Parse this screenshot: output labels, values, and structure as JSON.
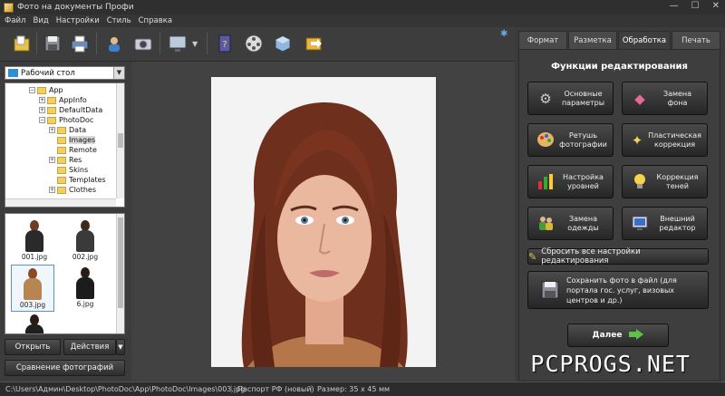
{
  "window": {
    "title": "Фото на документы Профи"
  },
  "menu": [
    "Файл",
    "Вид",
    "Настройки",
    "Стиль",
    "Справка"
  ],
  "toolbar": {
    "icons": [
      "open-folder-icon",
      "save-icon",
      "print-icon",
      "camera-user-icon",
      "webcam-icon",
      "monitor-icon",
      "help-book-icon",
      "film-icon",
      "box-3d-icon",
      "export-icon"
    ]
  },
  "folder": {
    "selected": "Рабочий стол"
  },
  "tree": {
    "items": [
      {
        "label": "App",
        "indent": 2,
        "toggle": "−"
      },
      {
        "label": "AppInfo",
        "indent": 3,
        "toggle": "+"
      },
      {
        "label": "DefaultData",
        "indent": 3,
        "toggle": "+"
      },
      {
        "label": "PhotoDoc",
        "indent": 3,
        "toggle": "−"
      },
      {
        "label": "Data",
        "indent": 4,
        "toggle": "+"
      },
      {
        "label": "Images",
        "indent": 4,
        "toggle": "",
        "selected": true
      },
      {
        "label": "Remote",
        "indent": 4,
        "toggle": ""
      },
      {
        "label": "Res",
        "indent": 4,
        "toggle": "+"
      },
      {
        "label": "Skins",
        "indent": 4,
        "toggle": ""
      },
      {
        "label": "Templates",
        "indent": 4,
        "toggle": ""
      },
      {
        "label": "Clothes",
        "indent": 4,
        "toggle": "+"
      }
    ]
  },
  "thumbnails": [
    {
      "label": "001.jpg",
      "selected": false
    },
    {
      "label": "002.jpg",
      "selected": false
    },
    {
      "label": "003.jpg",
      "selected": true
    },
    {
      "label": "6.jpg",
      "selected": false
    }
  ],
  "left_buttons": {
    "open": "Открыть",
    "actions": "Действия",
    "compare": "Сравнение фотографий"
  },
  "tabs": [
    {
      "label": "Формат",
      "active": false
    },
    {
      "label": "Разметка",
      "active": false
    },
    {
      "label": "Обработка",
      "active": true
    },
    {
      "label": "Печать",
      "active": false
    }
  ],
  "panel": {
    "title": "Функции редактирования",
    "functions": [
      {
        "label": "Основные параметры",
        "icon": "gears-icon"
      },
      {
        "label": "Замена фона",
        "icon": "background-replace-icon"
      },
      {
        "label": "Ретушь фотографии",
        "icon": "palette-icon"
      },
      {
        "label": "Пластическая коррекция",
        "icon": "magic-wand-icon"
      },
      {
        "label": "Настройка уровней",
        "icon": "levels-chart-icon"
      },
      {
        "label": "Коррекция теней",
        "icon": "lightbulb-icon"
      },
      {
        "label": "Замена одежды",
        "icon": "clothes-icon"
      },
      {
        "label": "Внешний редактор",
        "icon": "external-editor-icon"
      }
    ],
    "reset": "Сбросить все настройки редактирования",
    "save_file": "Сохранить фото в файл (для портала гос. услуг, визовых центров и др.)",
    "next": "Далее"
  },
  "status": {
    "path": "C:\\Users\\Админ\\Desktop\\PhotoDoc\\App\\PhotoDoc\\Images\\003.jpg",
    "format": "Паспорт РФ (новый)",
    "size": "Размер: 35 x 45 мм"
  },
  "watermark": "PCPROGS.NET"
}
